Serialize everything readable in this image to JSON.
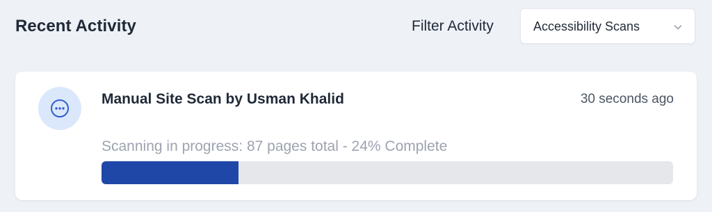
{
  "header": {
    "title": "Recent Activity",
    "filter_label": "Filter Activity",
    "filter_selected": "Accessibility Scans"
  },
  "activity": {
    "icon": "more-horizontal-icon",
    "title": "Manual Site Scan by Usman Khalid",
    "timestamp": "30 seconds ago",
    "status_text": "Scanning in progress: 87 pages total - 24% Complete",
    "progress_percent": 24
  },
  "colors": {
    "accent": "#1e47a8",
    "avatar_bg": "#dbe7fb",
    "icon_color": "#2f5fd0",
    "track": "#e5e7eb"
  }
}
